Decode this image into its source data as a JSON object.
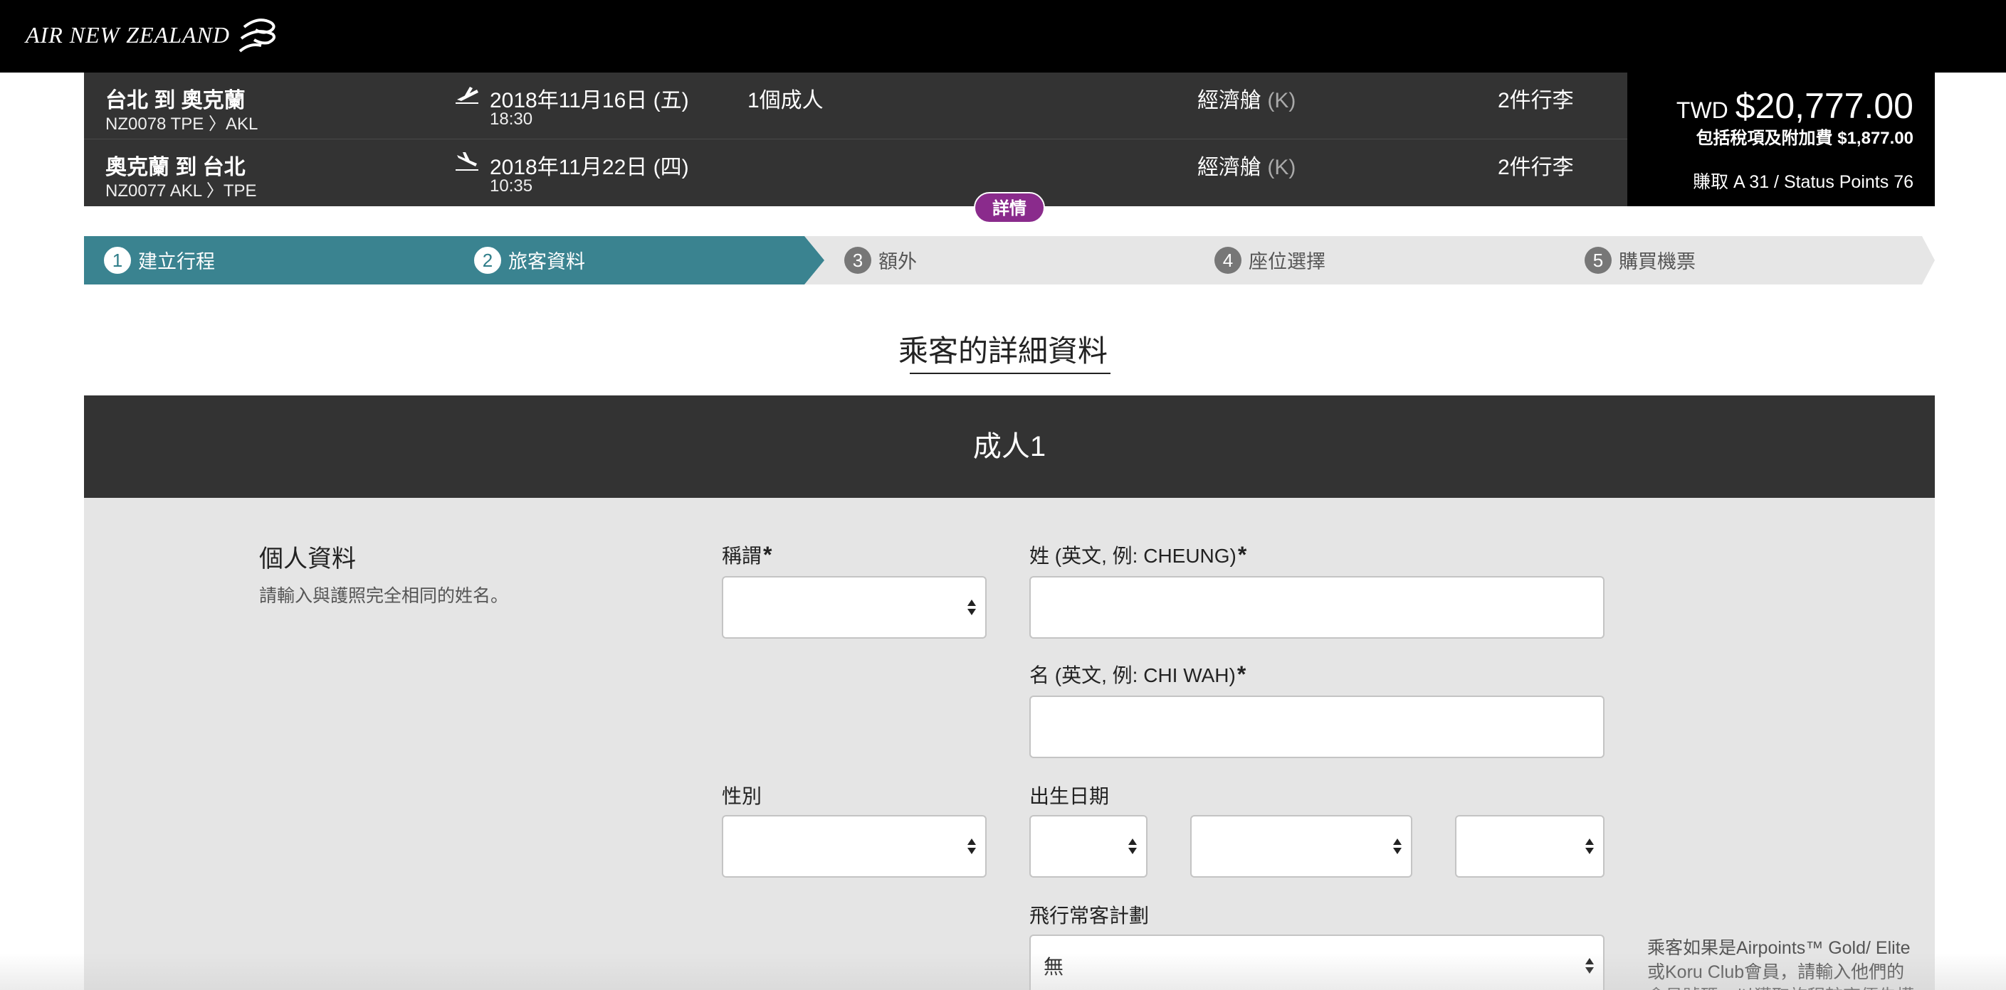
{
  "brand": {
    "name": "AIR NEW ZEALAND"
  },
  "itinerary": {
    "legs": [
      {
        "route": "台北 到 奧克蘭",
        "flight": "NZ0078   TPE 〉AKL",
        "date": "2018年11月16日 (五)",
        "time": "18:30",
        "passengers": "1個成人",
        "cabin": "經濟艙",
        "fare_code": "(K)",
        "baggage": "2件行李",
        "icon": "plane-takeoff-icon"
      },
      {
        "route": "奧克蘭 到 台北",
        "flight": "NZ0077   AKL 〉TPE",
        "date": "2018年11月22日 (四)",
        "time": "10:35",
        "passengers": "",
        "cabin": "經濟艙",
        "fare_code": "(K)",
        "baggage": "2件行李",
        "icon": "plane-landing-icon"
      }
    ],
    "price": {
      "currency": "TWD",
      "amount": "$20,777.00",
      "taxes": "包括稅項及附加費 $1,877.00",
      "earn": "賺取 A 31 / Status Points 76"
    },
    "details_button": "詳情"
  },
  "steps": [
    {
      "num": "1",
      "label": "建立行程",
      "state": "complete"
    },
    {
      "num": "2",
      "label": "旅客資料",
      "state": "current"
    },
    {
      "num": "3",
      "label": "額外",
      "state": "pending"
    },
    {
      "num": "4",
      "label": "座位選擇",
      "state": "pending"
    },
    {
      "num": "5",
      "label": "購買機票",
      "state": "pending"
    }
  ],
  "page_title": "乘客的詳細資料",
  "passenger_header": "成人1",
  "personal_section": {
    "title": "個人資料",
    "subtitle": "請輸入與護照完全相同的姓名。"
  },
  "form": {
    "title_label": "稱謂",
    "surname_label": "姓 (英文, 例: CHEUNG)",
    "given_name_label": "名 (英文, 例: CHI WAH)",
    "gender_label": "性別",
    "dob_label": "出生日期",
    "ffp_label": "飛行常客計劃",
    "ffp_value": "無",
    "required_mark": "*"
  },
  "side_note": "乘客如果是Airpoints™ Gold/ Elite或Koru Club會員，請輸入他們的會員號碼，以獲取旅程較高優先權益",
  "colors": {
    "accent": "#2f7d89",
    "brand_purple": "#8a2b8c",
    "dark": "#333333"
  }
}
